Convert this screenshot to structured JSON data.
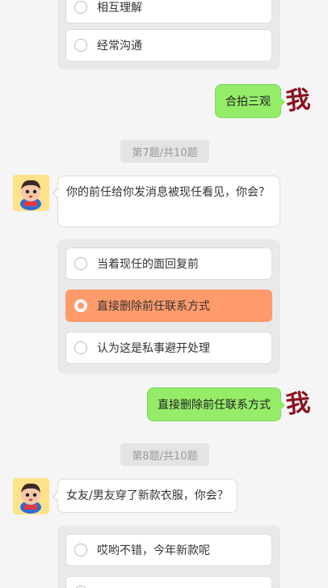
{
  "q6": {
    "options": [
      "相互理解",
      "经常沟通"
    ]
  },
  "answer6": "合拍三观",
  "me_avatar_text": "我",
  "q7": {
    "progress": "第7题/共10题",
    "question": "你的前任给你发消息被现任看见，你会？",
    "options": [
      "当着现任的面回复前",
      "直接删除前任联系方式",
      "认为这是私事避开处理"
    ],
    "selected_index": 1
  },
  "answer7": "直接删除前任联系方式",
  "q8": {
    "progress": "第8题/共10题",
    "question": "女友/男友穿了新款衣服，你会？",
    "options": [
      "哎哟不错，今年新款呢"
    ]
  },
  "colors": {
    "selected_option": "#ff9a6a",
    "my_bubble": "#95ec69",
    "background": "#f5f5f5"
  }
}
